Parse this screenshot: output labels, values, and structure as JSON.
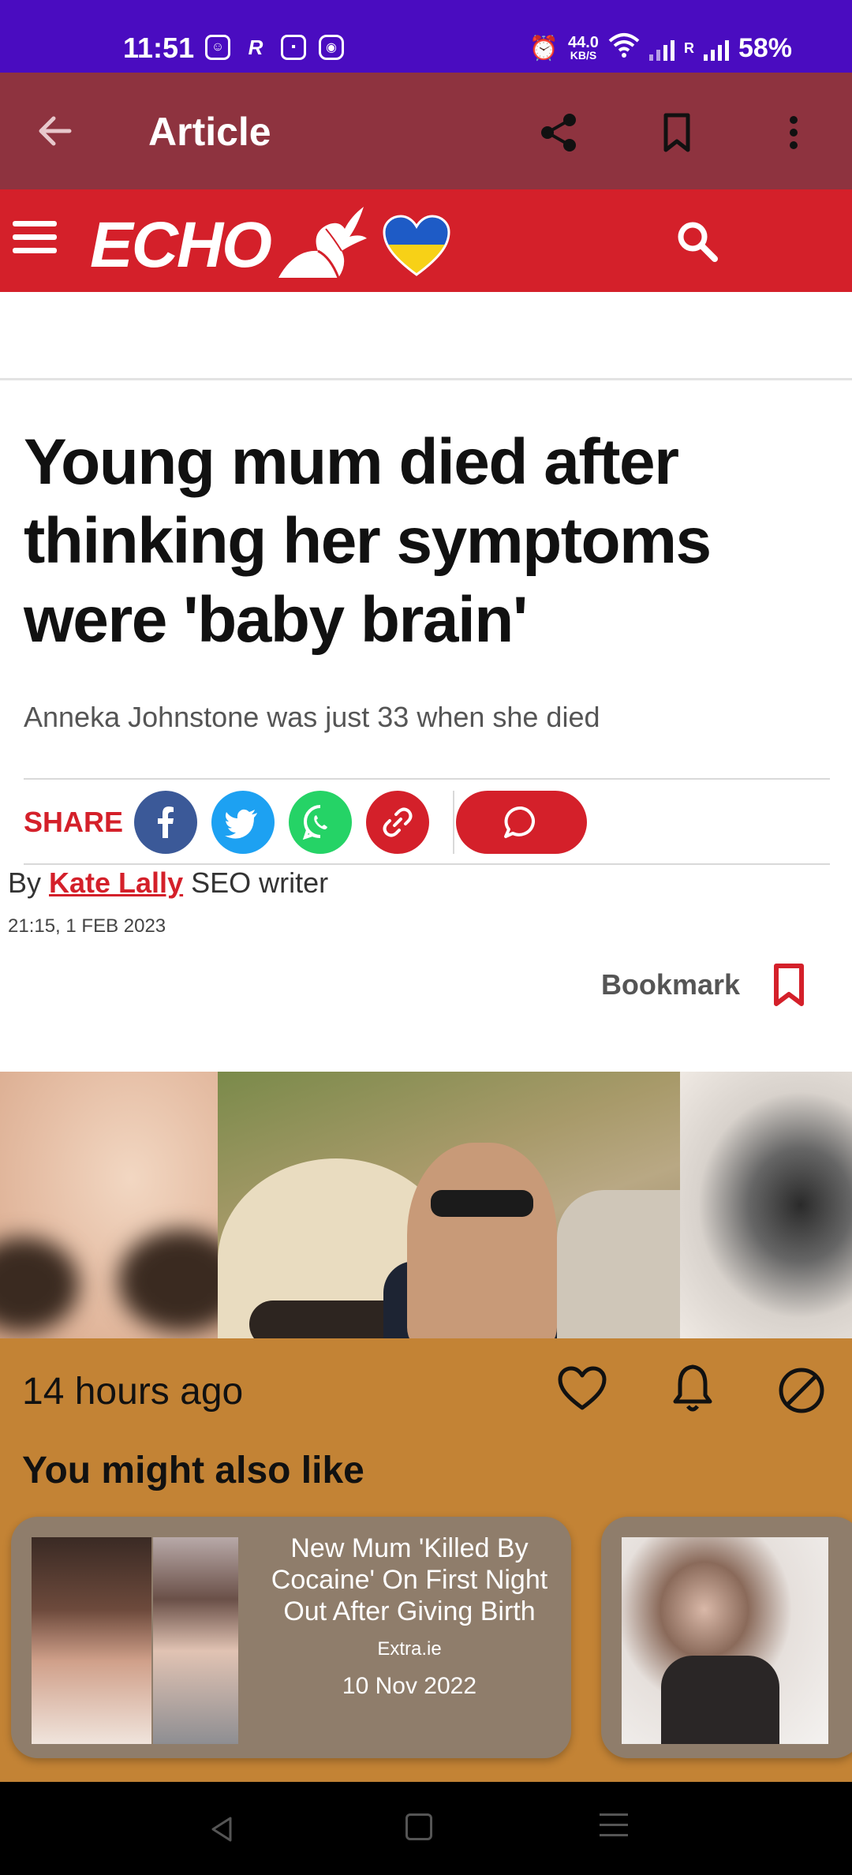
{
  "status_bar": {
    "time": "11:51",
    "speed_value": "44.0",
    "speed_unit": "KB/S",
    "network_label": "R",
    "battery": "58%"
  },
  "app_bar": {
    "title": "Article",
    "back_icon": "arrow-left-icon",
    "share_icon": "share-icon",
    "bookmark_icon": "bookmark-icon",
    "more_icon": "more-vertical-icon"
  },
  "site_header": {
    "logo_text": "ECHO",
    "brand_color": "#d4202a"
  },
  "article": {
    "headline": "Young mum died after thinking her symptoms were 'baby brain'",
    "standfirst": "Anneka Johnstone was just 33 when she died",
    "share_label": "SHARE",
    "byline_prefix": "By ",
    "author": "Kate Lally",
    "author_role": " SEO writer",
    "timestamp": "21:15, 1 FEB 2023",
    "bookmark_label": "Bookmark"
  },
  "feed_panel": {
    "time_ago": "14 hours ago",
    "section_title": "You might also like",
    "background": "#c38335",
    "cards": [
      {
        "title": "New Mum 'Killed By Cocaine' On First Night Out After Giving Birth",
        "source": "Extra.ie",
        "date": "10 Nov 2022"
      }
    ]
  },
  "colors": {
    "status_bar": "#4a0cc0",
    "app_bar": "#8e333f",
    "accent": "#d4202a",
    "facebook": "#3b5998",
    "twitter": "#1da1f2",
    "whatsapp": "#25d366"
  }
}
